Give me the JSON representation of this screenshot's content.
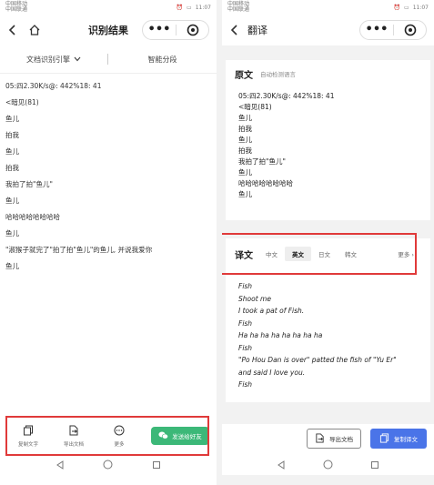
{
  "left": {
    "status": {
      "carrier1": "中国移动",
      "carrier2": "中国联通",
      "time": "11:07"
    },
    "title": "识别结果",
    "engine_label": "文档识别引擎",
    "smart_label": "智能分段",
    "lines": [
      "05:四2.30K/s@: 442%18: 41",
      "<暗见(81)",
      "鱼儿",
      "拍我",
      "鱼儿",
      "拍我",
      "我拍了拍\"鱼儿\"",
      "鱼儿",
      "哈哈哈哈哈哈哈哈",
      "鱼儿",
      "\"淑猴子就完了\"拍了拍\"鱼儿\"的鱼儿, 并说我爱你",
      "鱼儿"
    ],
    "toolbar": {
      "copy": "复制文字",
      "export": "导出文档",
      "more": "更多",
      "send": "发送给好友"
    }
  },
  "right": {
    "status": {
      "carrier1": "中国移动",
      "carrier2": "中国联通",
      "time": "11:07"
    },
    "title": "翻译",
    "source": {
      "title": "原文",
      "subtitle": "自动检测语言",
      "lines": [
        "05:四2.30K/s@: 442%18: 41",
        "<暗见(81)",
        "鱼儿",
        "拍我",
        "鱼儿",
        "拍我",
        "我拍了拍\"鱼儿\"",
        "鱼儿",
        "哈哈哈哈哈哈哈哈",
        "鱼儿"
      ]
    },
    "translation": {
      "title": "译文",
      "tabs": [
        "中文",
        "英文",
        "日文",
        "韩文"
      ],
      "more": "更多",
      "lines": [
        "Fish",
        "Shoot me",
        "I took a pat of Fish.",
        "Fish",
        "Ha ha ha ha ha ha ha ha",
        "Fish",
        "\"Po Hou Dan is over\" patted the fish of \"Yu Er\"",
        "and said I love you.",
        "Fish"
      ]
    },
    "buttons": {
      "export": "导出文档",
      "copy": "复制译文"
    }
  }
}
